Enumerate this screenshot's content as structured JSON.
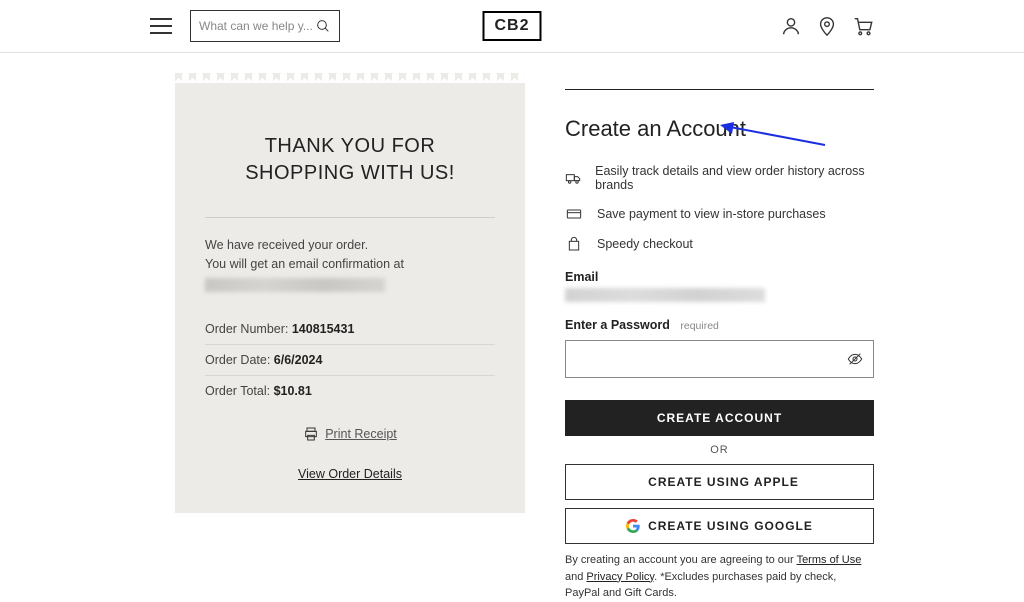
{
  "header": {
    "search_placeholder": "What can we help y...",
    "logo": "CB2"
  },
  "receipt": {
    "title_line1": "THANK YOU FOR",
    "title_line2": "SHOPPING WITH US!",
    "received_msg": "We have received your order.",
    "email_msg": "You will get an email confirmation at",
    "order_number_label": "Order Number:",
    "order_number": "140815431",
    "order_date_label": "Order Date:",
    "order_date": "6/6/2024",
    "order_total_label": "Order Total:",
    "order_total": "$10.81",
    "print_label": "Print Receipt",
    "view_details_label": "View Order Details"
  },
  "account": {
    "heading": "Create an Account",
    "benefits": {
      "tracking": "Easily track details and view order history across brands",
      "payment": "Save payment to view in-store purchases",
      "checkout": "Speedy checkout"
    },
    "email_label": "Email",
    "password_label": "Enter a Password",
    "password_required": "required",
    "create_button": "CREATE ACCOUNT",
    "or_label": "OR",
    "apple_button": "CREATE USING APPLE",
    "google_button": "CREATE USING GOOGLE",
    "legal_prefix": "By creating an account you are agreeing to our ",
    "legal_terms": "Terms of Use",
    "legal_and": " and ",
    "legal_privacy": "Privacy Policy",
    "legal_suffix": ". *Excludes purchases paid by check, PayPal and Gift Cards."
  }
}
